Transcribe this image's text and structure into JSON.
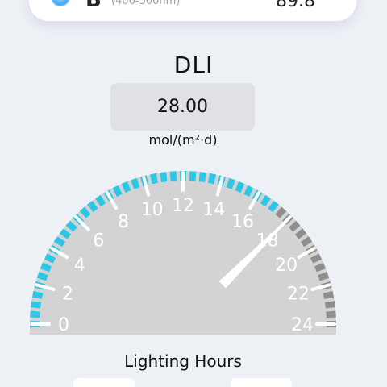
{
  "top_card": {
    "letter": "B",
    "range": "(400-500nm)",
    "value": "89.8",
    "dot_color": "#3fa9f5"
  },
  "dli": {
    "title": "DLI",
    "value": "28.00",
    "unit": "mol/(m²·d)"
  },
  "gauge": {
    "tick_labels": [
      "0",
      "2",
      "4",
      "6",
      "8",
      "10",
      "12",
      "14",
      "16",
      "18",
      "20",
      "22",
      "24"
    ],
    "min": 0,
    "max": 24,
    "needle_value": 18,
    "active_until": 17,
    "active_color": "#2cc6e6",
    "inactive_color": "#8e8e8e",
    "face_color": "#d3d3d3"
  },
  "lighting_hours": {
    "label": "Lighting Hours"
  }
}
